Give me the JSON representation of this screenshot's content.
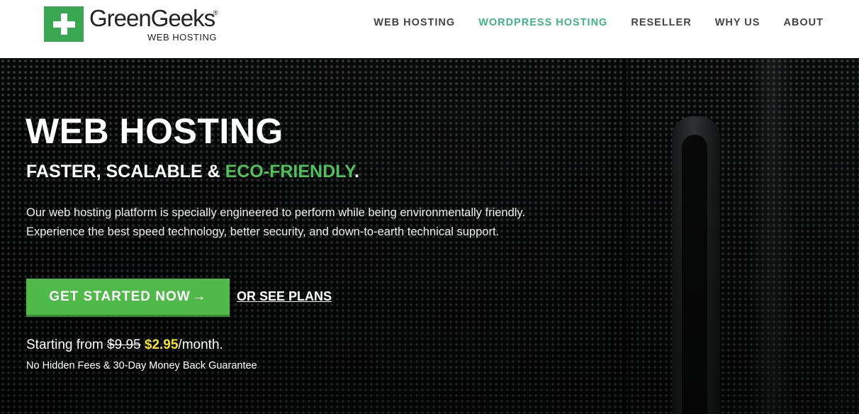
{
  "brand": {
    "name": "GreenGeeks",
    "registered_mark": "®",
    "subtitle": "WEB HOSTING",
    "logo_color": "#3aa852"
  },
  "nav": {
    "items": [
      {
        "label": "WEB HOSTING",
        "active": false
      },
      {
        "label": "WORDPRESS HOSTING",
        "active": true
      },
      {
        "label": "RESELLER",
        "active": false
      },
      {
        "label": "WHY US",
        "active": false
      },
      {
        "label": "ABOUT",
        "active": false
      }
    ],
    "active_color": "#40b486"
  },
  "hero": {
    "title": "WEB HOSTING",
    "subtitle_prefix": "FASTER, SCALABLE & ",
    "subtitle_highlight": "ECO-FRIENDLY",
    "subtitle_suffix": ".",
    "description": "Our web hosting platform is specially engineered to perform while being environmentally friendly. Experience the best speed technology, better security, and down-to-earth technical support.",
    "cta_label": "GET STARTED NOW",
    "cta_arrow_icon": "arrow-right-icon",
    "cta_color": "#4fb94a",
    "plans_link": "OR SEE PLANS",
    "price_prefix": "Starting from ",
    "price_old": "$9.95",
    "price_new": "$2.95",
    "price_suffix": "/month.",
    "price_new_color": "#f4e41b",
    "guarantee": "No Hidden Fees & 30-Day Money Back Guarantee"
  }
}
